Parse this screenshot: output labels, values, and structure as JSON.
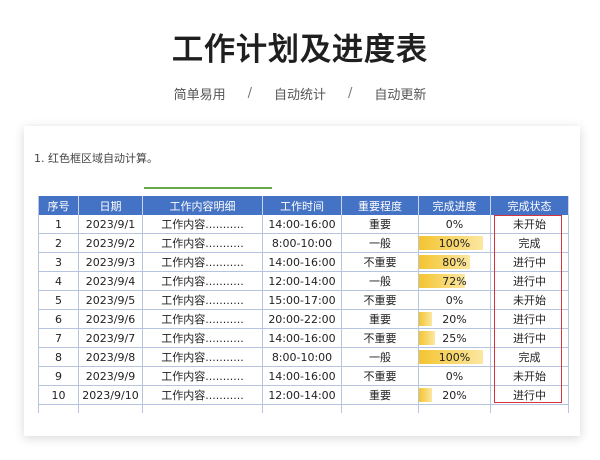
{
  "header": {
    "title": "工作计划及进度表",
    "subtitle_items": [
      "简单易用",
      "自动统计",
      "自动更新"
    ],
    "separator": "/"
  },
  "note": "1. 红色框区域自动计算。",
  "table": {
    "columns": [
      "序号",
      "日期",
      "工作内容明细",
      "工作时间",
      "重要程度",
      "完成进度",
      "完成状态"
    ],
    "rows": [
      {
        "no": "1",
        "date": "2023/9/1",
        "content": "工作内容...........",
        "time": "14:00-16:00",
        "importance": "重要",
        "progress": "0%",
        "progress_value": 0,
        "status": "未开始"
      },
      {
        "no": "2",
        "date": "2023/9/2",
        "content": "工作内容...........",
        "time": "8:00-10:00",
        "importance": "一般",
        "progress": "100%",
        "progress_value": 100,
        "status": "完成"
      },
      {
        "no": "3",
        "date": "2023/9/3",
        "content": "工作内容...........",
        "time": "14:00-16:00",
        "importance": "不重要",
        "progress": "80%",
        "progress_value": 80,
        "status": "进行中"
      },
      {
        "no": "4",
        "date": "2023/9/4",
        "content": "工作内容...........",
        "time": "12:00-14:00",
        "importance": "一般",
        "progress": "72%",
        "progress_value": 72,
        "status": "进行中"
      },
      {
        "no": "5",
        "date": "2023/9/5",
        "content": "工作内容...........",
        "time": "15:00-17:00",
        "importance": "不重要",
        "progress": "0%",
        "progress_value": 0,
        "status": "未开始"
      },
      {
        "no": "6",
        "date": "2023/9/6",
        "content": "工作内容...........",
        "time": "20:00-22:00",
        "importance": "重要",
        "progress": "20%",
        "progress_value": 20,
        "status": "进行中"
      },
      {
        "no": "7",
        "date": "2023/9/7",
        "content": "工作内容...........",
        "time": "14:00-16:00",
        "importance": "不重要",
        "progress": "25%",
        "progress_value": 25,
        "status": "进行中"
      },
      {
        "no": "8",
        "date": "2023/9/8",
        "content": "工作内容...........",
        "time": "8:00-10:00",
        "importance": "一般",
        "progress": "100%",
        "progress_value": 100,
        "status": "完成"
      },
      {
        "no": "9",
        "date": "2023/9/9",
        "content": "工作内容...........",
        "time": "14:00-16:00",
        "importance": "不重要",
        "progress": "0%",
        "progress_value": 0,
        "status": "未开始"
      },
      {
        "no": "10",
        "date": "2023/9/10",
        "content": "工作内容...........",
        "time": "12:00-14:00",
        "importance": "重要",
        "progress": "20%",
        "progress_value": 20,
        "status": "进行中"
      }
    ]
  },
  "colors": {
    "header_bg": "#4472c4",
    "progress_fill": "#f4c430",
    "highlight_border": "#d9343b",
    "accent_line": "#6aa84f"
  }
}
